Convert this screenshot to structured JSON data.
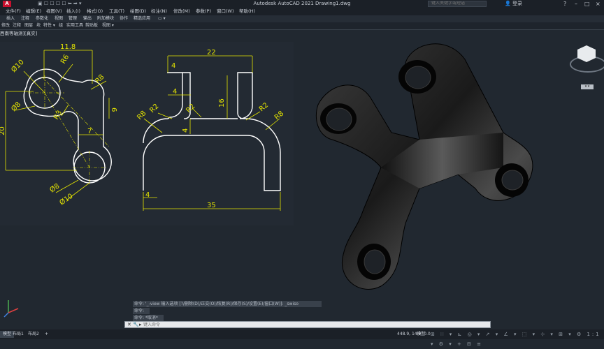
{
  "app": {
    "title": "Autodesk AutoCAD 2021    Drawing1.dwg",
    "logo": "A",
    "quick_access": "▣ ☐ ☐ ☐ ☐ ⬅ ➡ ▾",
    "search_placeholder": "键入关键字或短语",
    "login": "登录",
    "window_buttons": [
      "–",
      "□",
      "×"
    ]
  },
  "menu": [
    "文件(F)",
    "编辑(E)",
    "视图(V)",
    "插入(I)",
    "格式(O)",
    "工具(T)",
    "绘图(D)",
    "标注(N)",
    "修改(M)",
    "参数(P)",
    "窗口(W)",
    "帮助(H)"
  ],
  "tabs": [
    "插入",
    "注释",
    "参数化",
    "视图",
    "管理",
    "输出",
    "附加模块",
    "协作",
    "精选应用",
    "▭ ▾"
  ],
  "panels": [
    "修改",
    "注释",
    "图层",
    "块",
    "特性 ▾",
    "组",
    "实用工具",
    "剪贴板",
    "视图 ▾"
  ],
  "viewport_label": "西南等轴测][真实]",
  "viewcube": {
    "menu": "▾ ▾"
  },
  "drawing": {
    "dims": {
      "d1": "11.8",
      "d2": "Ø10",
      "d3": "R6",
      "d4": "R8",
      "d5": "6",
      "d6": "Ø8",
      "d7": "R3",
      "d8": "20",
      "d9": "7",
      "d10": "Ø8",
      "d11": "Ø10",
      "e1": "22",
      "e2": "4",
      "e3": "4",
      "e4": "16",
      "e5": "R2",
      "e6": "R8",
      "e7": "R2",
      "e8": "4",
      "e9": "R2",
      "e10": "R8",
      "e11": "4",
      "e12": "35"
    }
  },
  "command": {
    "history": [
      "命令: '_-view 输入选项 [?/删除(D)/正交(O)/恢复(R)/保存(S)/设置(E)/窗口(W)]: _swiso",
      "命令:",
      "命令: *取消*"
    ],
    "placeholder": "键入命令",
    "icons": [
      "✕",
      "🔧",
      "▸"
    ]
  },
  "status": {
    "layout_tabs": [
      "模型",
      "布局1",
      "布局2",
      "+"
    ],
    "coords": "448.9, 14.9, 0.0",
    "model": "模型",
    "icons": "⊞ ∷ ▾ ⊾ ◎ ▾ ↗ ▾ ∠ ▾ ⬚ ▾ ⊹ ▾ ⊞ ▾ ⚙ 1:1 ▾ ⚙ ▾ + ⊟ ≡"
  },
  "colors": {
    "accent": "#c8102e",
    "dimension": "#e6e600",
    "bg": "#212830"
  }
}
